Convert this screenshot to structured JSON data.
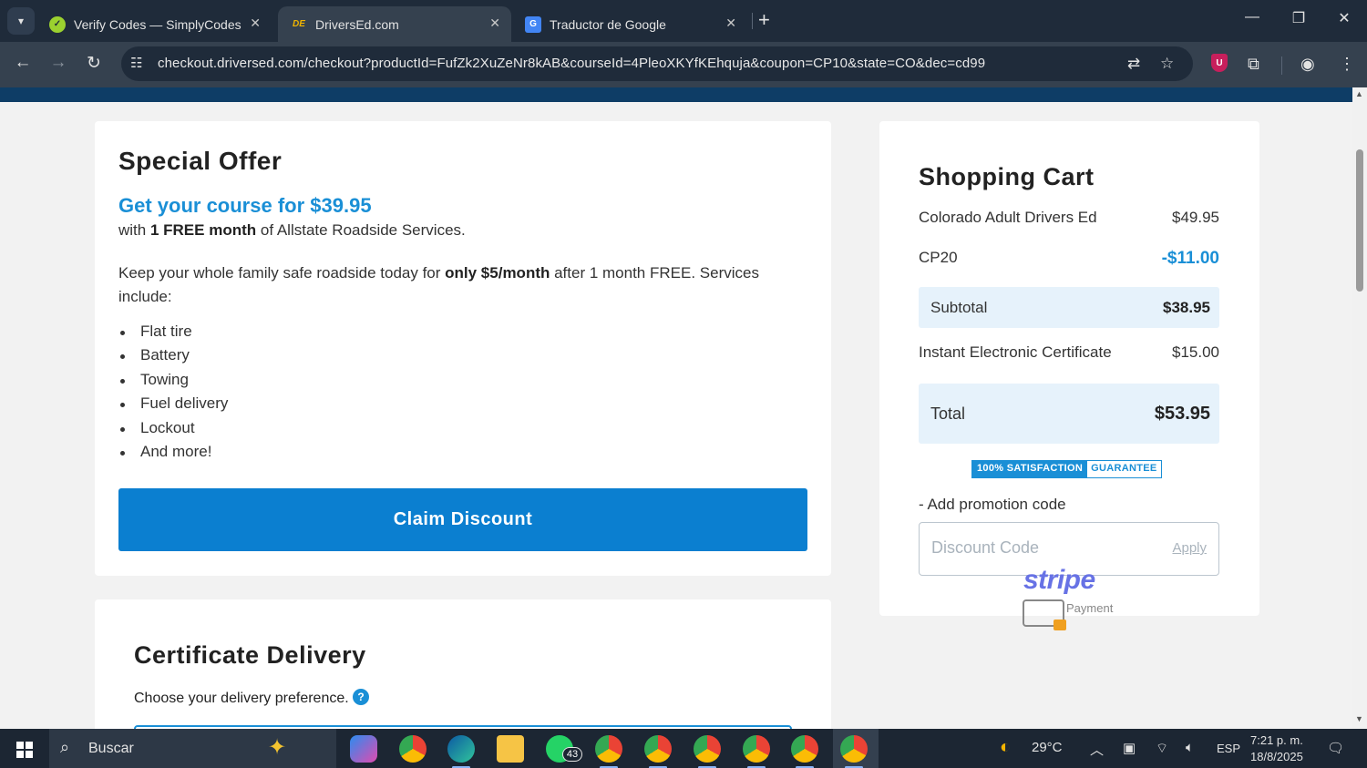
{
  "browser": {
    "tabs": [
      {
        "title": "Verify Codes — SimplyCodes",
        "favicon": "simplycodes-icon",
        "active": false
      },
      {
        "title": "DriversEd.com",
        "favicon": "driversed-icon",
        "active": true
      },
      {
        "title": "Traductor de Google",
        "favicon": "google-translate-icon",
        "active": false
      }
    ],
    "url": "checkout.driversed.com/checkout?productId=FufZk2XuZeNr8kAB&courseId=4PleoXKYfKEhquja&coupon=CP10&state=CO&dec=cd99",
    "favicon_labels": {
      "driversed": "DE",
      "translate": "G"
    }
  },
  "offer": {
    "title": "Special Offer",
    "headline": "Get your course for $39.95",
    "sub_prefix": "with ",
    "sub_bold": "1 FREE month",
    "sub_suffix": " of Allstate Roadside Services.",
    "desc_prefix": "Keep your whole family safe roadside today for ",
    "desc_bold": "only $5/month",
    "desc_suffix": " after 1 month FREE. Services include:",
    "services": [
      "Flat tire",
      "Battery",
      "Towing",
      "Fuel delivery",
      "Lockout",
      "And more!"
    ],
    "claim_button": "Claim Discount"
  },
  "certificate": {
    "title": "Certificate Delivery",
    "subtitle": "Choose your delivery preference.",
    "help": "?"
  },
  "cart": {
    "title": "Shopping Cart",
    "items": [
      {
        "name": "Colorado Adult Drivers Ed",
        "amount": "$49.95"
      },
      {
        "name": "CP20",
        "amount": "-$11.00"
      }
    ],
    "subtotal_label": "Subtotal",
    "subtotal": "$38.95",
    "certificate_label": "Instant Electronic Certificate",
    "certificate_amount": "$15.00",
    "total_label": "Total",
    "total": "$53.95",
    "guarantee_left": "100% SATISFACTION",
    "guarantee_right": "GUARANTEE",
    "promo_label": "- Add promotion code",
    "promo_placeholder": "Discount Code",
    "apply": "Apply"
  },
  "payment": {
    "brand": "stripe",
    "label": "Payment"
  },
  "taskbar": {
    "search_placeholder": "Buscar",
    "weather": "29°C",
    "language": "ESP",
    "time": "7:21 p. m.",
    "date": "18/8/2025",
    "whatsapp_badge": "43"
  },
  "colors": {
    "accent": "#1a8fd6",
    "button": "#0b7fd0",
    "header_band": "#0e3d66",
    "tint": "#e6f2fb"
  }
}
